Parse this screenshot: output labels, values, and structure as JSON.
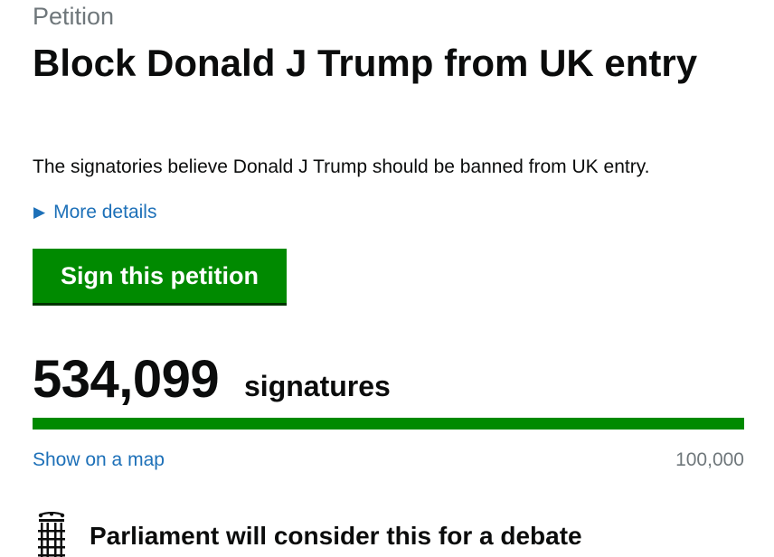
{
  "petition": {
    "eyebrow": "Petition",
    "title": "Block Donald J Trump from UK entry",
    "summary": "The signatories believe Donald J Trump should be banned from UK entry.",
    "details_toggle": {
      "icon": "triangle-right-icon",
      "label": "More details"
    },
    "sign_button": "Sign this petition"
  },
  "signatures": {
    "count": "534,099",
    "label": "signatures",
    "progress_fraction": 1.0,
    "show_map_link": "Show on a map",
    "threshold": "100,000"
  },
  "debate_notice": {
    "icon": "portcullis-icon",
    "text": "Parliament will consider this for a debate"
  },
  "colors": {
    "green": "#008a00",
    "link": "#1d70b8",
    "muted": "#6f777b",
    "text": "#0b0c0c"
  }
}
